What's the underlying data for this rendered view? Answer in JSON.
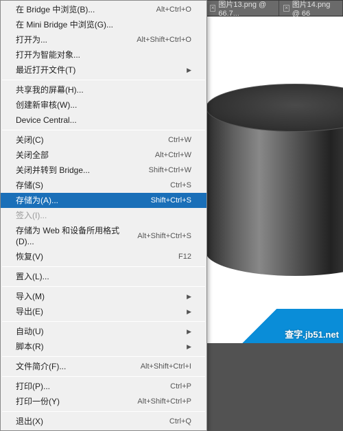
{
  "tabs": [
    {
      "label": "图片13.png @ 66.7..."
    },
    {
      "label": "图片14.png @ 66"
    }
  ],
  "menu": {
    "groups": [
      [
        {
          "label": "在 Bridge 中浏览(B)...",
          "shortcut": "Alt+Ctrl+O",
          "interact": true
        },
        {
          "label": "在 Mini Bridge 中浏览(G)...",
          "shortcut": "",
          "interact": true
        },
        {
          "label": "打开为...",
          "shortcut": "Alt+Shift+Ctrl+O",
          "interact": true
        },
        {
          "label": "打开为智能对象...",
          "shortcut": "",
          "interact": true
        },
        {
          "label": "最近打开文件(T)",
          "shortcut": "",
          "sub": true,
          "interact": true
        }
      ],
      [
        {
          "label": "共享我的屏幕(H)...",
          "shortcut": "",
          "interact": true
        },
        {
          "label": "创建新审核(W)...",
          "shortcut": "",
          "interact": true
        },
        {
          "label": "Device Central...",
          "shortcut": "",
          "interact": true
        }
      ],
      [
        {
          "label": "关闭(C)",
          "shortcut": "Ctrl+W",
          "interact": true
        },
        {
          "label": "关闭全部",
          "shortcut": "Alt+Ctrl+W",
          "interact": true
        },
        {
          "label": "关闭并转到 Bridge...",
          "shortcut": "Shift+Ctrl+W",
          "interact": true
        },
        {
          "label": "存储(S)",
          "shortcut": "Ctrl+S",
          "interact": true
        },
        {
          "label": "存储为(A)...",
          "shortcut": "Shift+Ctrl+S",
          "highlight": true,
          "interact": true
        },
        {
          "label": "签入(I)...",
          "shortcut": "",
          "disabled": true,
          "interact": false
        },
        {
          "label": "存储为 Web 和设备所用格式(D)...",
          "shortcut": "Alt+Shift+Ctrl+S",
          "interact": true
        },
        {
          "label": "恢复(V)",
          "shortcut": "F12",
          "interact": true
        }
      ],
      [
        {
          "label": "置入(L)...",
          "shortcut": "",
          "interact": true
        }
      ],
      [
        {
          "label": "导入(M)",
          "shortcut": "",
          "sub": true,
          "interact": true
        },
        {
          "label": "导出(E)",
          "shortcut": "",
          "sub": true,
          "interact": true
        }
      ],
      [
        {
          "label": "自动(U)",
          "shortcut": "",
          "sub": true,
          "interact": true
        },
        {
          "label": "脚本(R)",
          "shortcut": "",
          "sub": true,
          "interact": true
        }
      ],
      [
        {
          "label": "文件简介(F)...",
          "shortcut": "Alt+Shift+Ctrl+I",
          "interact": true
        }
      ],
      [
        {
          "label": "打印(P)...",
          "shortcut": "Ctrl+P",
          "interact": true
        },
        {
          "label": "打印一份(Y)",
          "shortcut": "Alt+Shift+Ctrl+P",
          "interact": true
        }
      ],
      [
        {
          "label": "退出(X)",
          "shortcut": "Ctrl+Q",
          "interact": true
        }
      ]
    ]
  },
  "watermark": "查字.jb51.net"
}
